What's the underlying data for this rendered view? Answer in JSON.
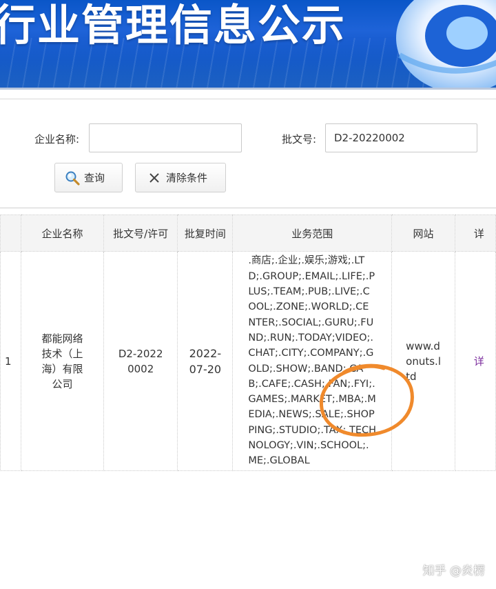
{
  "banner": {
    "title": "行业管理信息公示"
  },
  "search": {
    "company_label": "企业名称:",
    "company_value": "",
    "approval_label": "批文号:",
    "approval_value": "D2-20220002",
    "query_label": "查询",
    "clear_label": "清除条件"
  },
  "table": {
    "headers": [
      "",
      "企业名称",
      "批文号/许可",
      "批复时间",
      "业务范围",
      "网站",
      "详"
    ],
    "row": {
      "index": "1",
      "company": "都能网络技术（上海）有限公司",
      "approval_no": "D2-20220002",
      "approval_date": "2022-07-20",
      "scope": ".商店;.企业;.娱乐;游戏;.LTD;.GROUP;.EMAIL;.LIFE;.PLUS;.TEAM;.PUB;.LIVE;.COOL;.ZONE;.WORLD;.CENTER;.SOCIAL;.GURU;.FUND;.RUN;.TODAY;VIDEO;.CHAT;.CITY;.COMPANY;.GOLD;.SHOW;.BAND;.CAB;.CAFE;.CASH;.FAN;.FYI;.GAMES;.MARKET;.MBA;.MEDIA;.NEWS;.SALE;.SHOPPING;.STUDIO;.TAX;.TECHNOLOGY;.VIN;.SCHOOL;.ME;.GLOBAL",
      "website": "www.donuts.ltd",
      "detail": "详"
    }
  },
  "watermark": "知乎 @炎楞",
  "icons": {
    "query": "search-magnifier-icon",
    "clear": "close-x-icon",
    "annotation": "orange-hand-drawn-circle"
  },
  "colors": {
    "banner_blue": "#0a56c8",
    "annotation": "#f08a2c",
    "detail_link": "#7a2b9c"
  }
}
